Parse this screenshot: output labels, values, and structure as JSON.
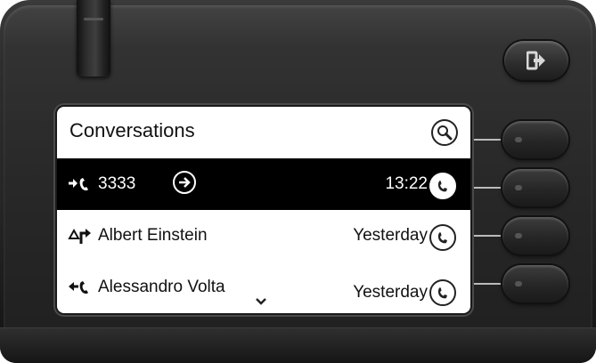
{
  "screen": {
    "title": "Conversations",
    "search_icon": "search-icon",
    "rows": [
      {
        "icon": "outgoing-call-icon",
        "name": "3333",
        "time": "13:22",
        "selected": true,
        "action_icon": "arrow-right-circle-icon",
        "call_icon": "phone-handset-icon"
      },
      {
        "icon": "forwarded-call-icon",
        "name": "Albert Einstein",
        "time": "Yesterday",
        "selected": false,
        "call_icon": "phone-handset-icon"
      },
      {
        "icon": "incoming-call-icon",
        "name": "Alessandro Volta",
        "time": "Yesterday",
        "selected": false,
        "call_icon": "phone-handset-icon"
      }
    ],
    "more_indicator": "chevron-down-icon"
  },
  "hardware": {
    "logout_key_icon": "logout-icon",
    "side_keys": 4
  },
  "colors": {
    "selection": "#000000",
    "screen_bg": "#ffffff",
    "body": "#2a2a2a"
  }
}
